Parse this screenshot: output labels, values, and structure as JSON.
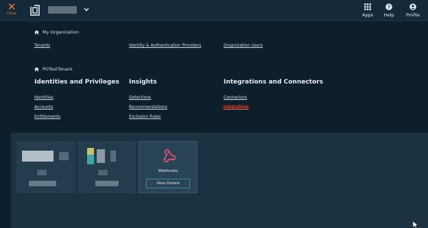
{
  "topbar": {
    "close_label": "Close",
    "actions": [
      {
        "label": "Apps",
        "icon": "grid-icon"
      },
      {
        "label": "Help",
        "icon": "help-icon"
      },
      {
        "label": "Profile",
        "icon": "user-icon"
      }
    ]
  },
  "menu": {
    "org_heading": "My Organization",
    "org_links": [
      "Tenants",
      "Identity & Authentication Providers",
      "Organization Users"
    ],
    "tenant_heading": "POTestTenant",
    "columns": [
      {
        "title": "Identities and Privileges",
        "links": [
          "Identities",
          "Accounts",
          "Entitlements"
        ]
      },
      {
        "title": "Insights",
        "links": [
          "Detections",
          "Recommendations",
          "Exclusion Rules"
        ]
      },
      {
        "title": "Integrations and Connectors",
        "links": [
          "Connectors",
          "Integrations"
        ]
      }
    ],
    "active_link": "Integrations"
  },
  "integrations": {
    "webhook_card": {
      "name": "Webhooks",
      "button_label": "View Details"
    }
  },
  "colors": {
    "background": "#0d1e2c",
    "topbar": "#14293a",
    "accent_orange": "#f07a2a",
    "active_link": "#f0705a",
    "webhook_icon": "#e0506a",
    "button_border": "#3e8a96"
  }
}
